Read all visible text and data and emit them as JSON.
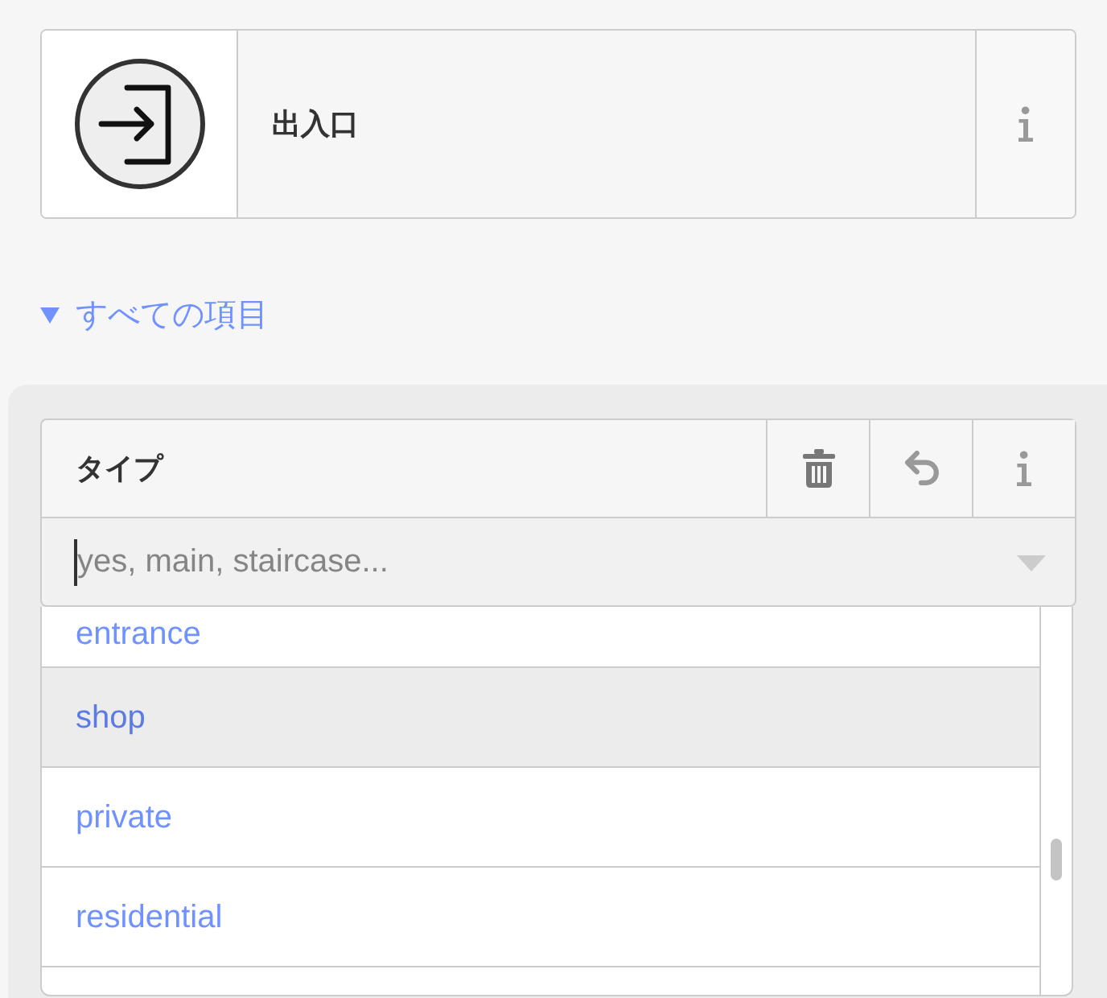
{
  "preset": {
    "name": "出入口"
  },
  "all_fields_toggle": {
    "label": "すべての項目",
    "expanded": true
  },
  "field": {
    "label": "タイプ",
    "combo": {
      "placeholder": "yes, main, staircase...",
      "focused": true
    }
  },
  "dropdown": {
    "options": [
      {
        "label": "entrance",
        "selected": false
      },
      {
        "label": "shop",
        "selected": true
      },
      {
        "label": "private",
        "selected": false
      },
      {
        "label": "residential",
        "selected": false
      }
    ]
  }
}
